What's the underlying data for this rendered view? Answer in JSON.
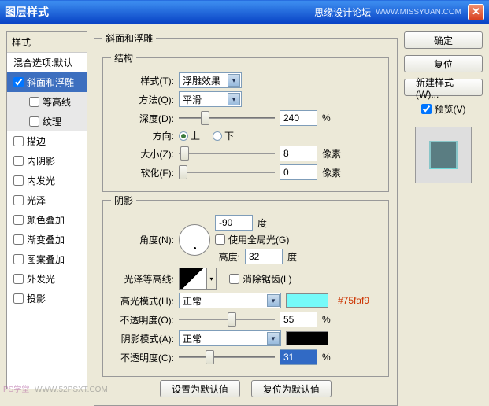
{
  "title": "图层样式",
  "forum": "思缘设计论坛",
  "url": "WWW.MISSYUAN.COM",
  "sidebar": {
    "header": "样式",
    "blending": "混合选项:默认",
    "items": [
      {
        "label": "斜面和浮雕",
        "checked": true,
        "selected": true
      },
      {
        "label": "等高线",
        "checked": false,
        "sub": true
      },
      {
        "label": "纹理",
        "checked": false,
        "sub": true
      },
      {
        "label": "描边",
        "checked": false
      },
      {
        "label": "内阴影",
        "checked": false
      },
      {
        "label": "内发光",
        "checked": false
      },
      {
        "label": "光泽",
        "checked": false
      },
      {
        "label": "颜色叠加",
        "checked": false
      },
      {
        "label": "渐变叠加",
        "checked": false
      },
      {
        "label": "图案叠加",
        "checked": false
      },
      {
        "label": "外发光",
        "checked": false
      },
      {
        "label": "投影",
        "checked": false
      }
    ]
  },
  "bevel": {
    "group_title": "斜面和浮雕",
    "structure_title": "结构",
    "style_lbl": "样式(T):",
    "style_val": "浮雕效果",
    "technique_lbl": "方法(Q):",
    "technique_val": "平滑",
    "depth_lbl": "深度(D):",
    "depth_val": "240",
    "depth_unit": "%",
    "direction_lbl": "方向:",
    "up": "上",
    "down": "下",
    "size_lbl": "大小(Z):",
    "size_val": "8",
    "size_unit": "像素",
    "soften_lbl": "软化(F):",
    "soften_val": "0",
    "soften_unit": "像素"
  },
  "shading": {
    "title": "阴影",
    "angle_lbl": "角度(N):",
    "angle_val": "-90",
    "angle_unit": "度",
    "use_global": "使用全局光(G)",
    "altitude_lbl": "高度:",
    "altitude_val": "32",
    "altitude_unit": "度",
    "gloss_lbl": "光泽等高线:",
    "antialias": "消除锯齿(L)",
    "highlight_mode_lbl": "高光模式(H):",
    "highlight_mode_val": "正常",
    "highlight_color": "#75faf9",
    "highlight_color_note": "#75faf9",
    "highlight_opacity_lbl": "不透明度(O):",
    "highlight_opacity_val": "55",
    "pct": "%",
    "shadow_mode_lbl": "阴影模式(A):",
    "shadow_mode_val": "正常",
    "shadow_color": "#000000",
    "shadow_opacity_lbl": "不透明度(C):",
    "shadow_opacity_val": "31"
  },
  "buttons": {
    "ok": "确定",
    "cancel": "复位",
    "new_style": "新建样式(W)...",
    "preview": "预览(V)",
    "make_default": "设置为默认值",
    "reset_default": "复位为默认值"
  },
  "watermarks": {
    "a": "PS学堂",
    "b": "WWW.52PSXT.COM"
  }
}
